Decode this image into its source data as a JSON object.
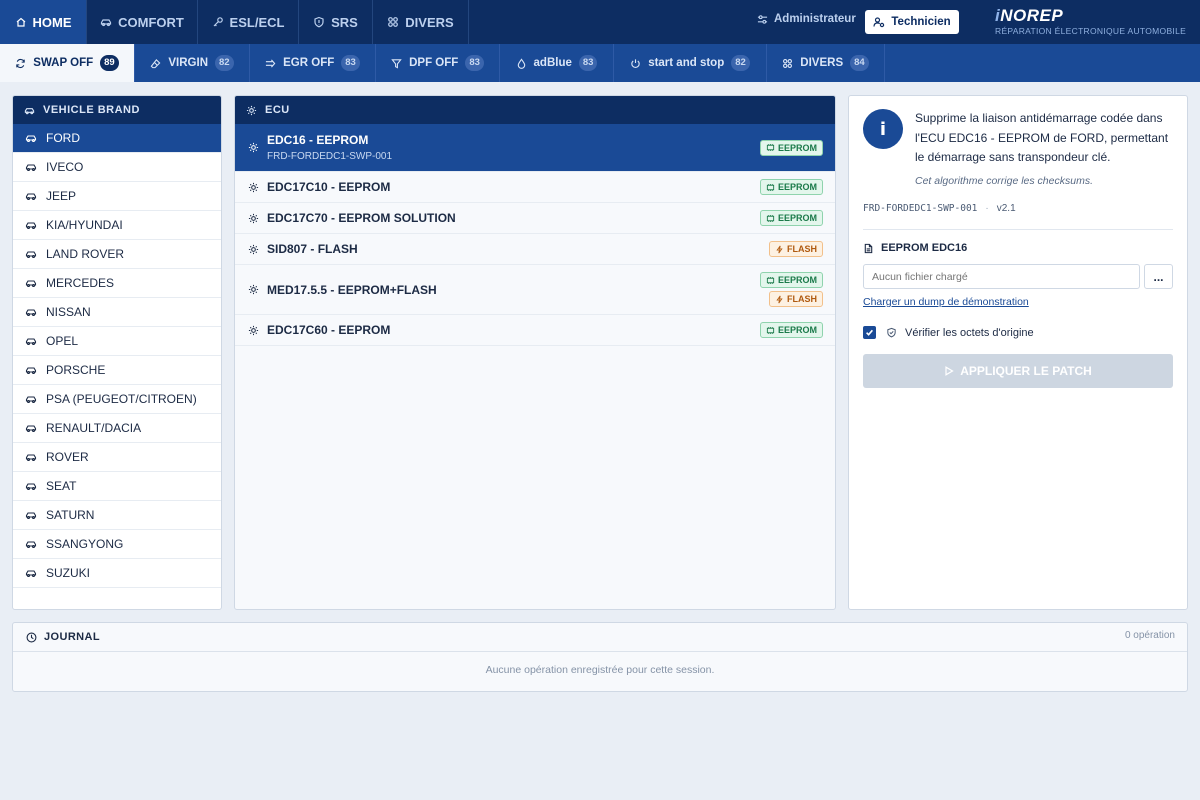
{
  "topnav": {
    "tabs": [
      {
        "label": "HOME",
        "icon": "home-icon",
        "active": true
      },
      {
        "label": "COMFORT",
        "icon": "car-icon",
        "active": false
      },
      {
        "label": "ESL/ECL",
        "icon": "key-icon",
        "active": false
      },
      {
        "label": "SRS",
        "icon": "shield-icon",
        "active": false
      },
      {
        "label": "DIVERS",
        "icon": "grid-icon",
        "active": false
      }
    ],
    "admin_label": "Administrateur",
    "tech_label": "Technicien",
    "brand": {
      "logo_prefix": "i",
      "logo_rest": "NOREP",
      "tagline": "RÉPARATION ÉLECTRONIQUE AUTOMOBILE"
    }
  },
  "subnav": {
    "tabs": [
      {
        "label": "SWAP OFF",
        "count": "89",
        "icon": "refresh-icon",
        "active": true
      },
      {
        "label": "VIRGIN",
        "count": "82",
        "icon": "eraser-icon",
        "active": false
      },
      {
        "label": "EGR OFF",
        "count": "83",
        "icon": "arrow-icon",
        "active": false
      },
      {
        "label": "DPF OFF",
        "count": "83",
        "icon": "filter-icon",
        "active": false
      },
      {
        "label": "adBlue",
        "count": "83",
        "icon": "drop-icon",
        "active": false
      },
      {
        "label": "start and stop",
        "count": "82",
        "icon": "power-icon",
        "active": false
      },
      {
        "label": "DIVERS",
        "count": "84",
        "icon": "grid-icon",
        "active": false
      }
    ]
  },
  "brands": {
    "title": "VEHICLE BRAND",
    "items": [
      "FORD",
      "IVECO",
      "JEEP",
      "KIA/HYUNDAI",
      "LAND ROVER",
      "MERCEDES",
      "NISSAN",
      "OPEL",
      "PORSCHE",
      "PSA (PEUGEOT/CITROEN)",
      "RENAULT/DACIA",
      "ROVER",
      "SEAT",
      "SATURN",
      "SSANGYONG",
      "SUZUKI"
    ],
    "selected": "FORD"
  },
  "ecu": {
    "title": "ECU",
    "items": [
      {
        "name": "EDC16 - EEPROM",
        "code": "FRD-FORDEDC1-SWP-001",
        "badges": [
          "EEPROM"
        ],
        "active": true
      },
      {
        "name": "EDC17C10 - EEPROM",
        "code": "",
        "badges": [
          "EEPROM"
        ],
        "active": false
      },
      {
        "name": "EDC17C70 - EEPROM SOLUTION",
        "code": "",
        "badges": [
          "EEPROM"
        ],
        "active": false
      },
      {
        "name": "SID807 - FLASH",
        "code": "",
        "badges": [
          "FLASH"
        ],
        "active": false
      },
      {
        "name": "MED17.5.5 - EEPROM+FLASH",
        "code": "",
        "badges": [
          "EEPROM",
          "FLASH"
        ],
        "active": false
      },
      {
        "name": "EDC17C60 - EEPROM",
        "code": "",
        "badges": [
          "EEPROM"
        ],
        "active": false
      }
    ]
  },
  "info": {
    "icon_letter": "i",
    "description": "Supprime la liaison antidémarrage codée dans l'ECU EDC16 - EEPROM de FORD, permettant le démarrage sans transpondeur clé.",
    "note": "Cet algorithme corrige les checksums.",
    "code": "FRD-FORDEDC1-SWP-001",
    "separator": "·",
    "version": "v2.1",
    "file_title": "EEPROM EDC16",
    "file_placeholder": "Aucun fichier chargé",
    "browse_label": "...",
    "demo_link": "Charger un dump de démonstration",
    "verify_label": "Vérifier les octets d'origine",
    "verify_checked": true,
    "apply_label": "APPLIQUER LE PATCH"
  },
  "journal": {
    "title": "JOURNAL",
    "count": "0 opération",
    "empty": "Aucune opération enregistrée pour cette session."
  },
  "colors": {
    "nav_dark": "#0d2d62",
    "nav_blue": "#1a4a96",
    "eeprom_green": "#1b7a4a",
    "flash_orange": "#b05a10"
  }
}
